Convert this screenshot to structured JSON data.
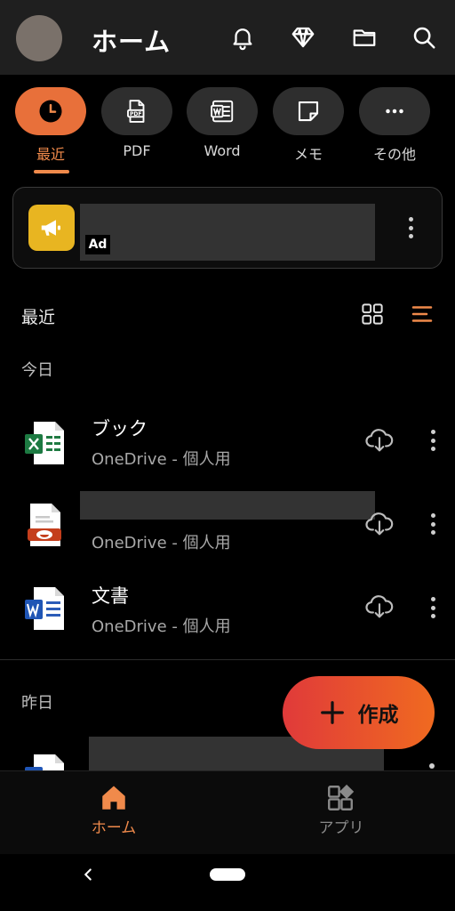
{
  "header": {
    "title": "ホーム",
    "icons": [
      "bell-icon",
      "premium-diamond-icon",
      "folder-icon",
      "search-icon"
    ]
  },
  "categories": [
    {
      "label": "最近",
      "icon": "clock-icon",
      "active": true
    },
    {
      "label": "PDF",
      "icon": "pdf-icon",
      "active": false
    },
    {
      "label": "Word",
      "icon": "word-icon",
      "active": false
    },
    {
      "label": "メモ",
      "icon": "sticky-note-icon",
      "active": false
    },
    {
      "label": "その他",
      "icon": "more-icon",
      "active": false
    }
  ],
  "ad": {
    "badge": "Ad",
    "icon": "megaphone-icon"
  },
  "recent": {
    "title": "最近",
    "view_icons": [
      "grid-view-icon",
      "list-view-icon"
    ]
  },
  "groups": [
    {
      "label": "今日",
      "files": [
        {
          "name": "ブック",
          "location": "OneDrive - 個人用",
          "type": "excel"
        },
        {
          "name": "",
          "location": "OneDrive - 個人用",
          "type": "powerpoint"
        },
        {
          "name": "文書",
          "location": "OneDrive - 個人用",
          "type": "word"
        }
      ]
    },
    {
      "label": "昨日",
      "files": [
        {
          "name": "",
          "location": "",
          "type": "word"
        }
      ]
    }
  ],
  "fab": {
    "label": "作成"
  },
  "bottom_nav": [
    {
      "label": "ホーム",
      "icon": "home-icon",
      "active": true
    },
    {
      "label": "アプリ",
      "icon": "apps-icon",
      "active": false
    }
  ],
  "colors": {
    "accent": "#F08A4B",
    "background": "#000000",
    "header": "#1F1F1F",
    "fab_start": "#E03A3A",
    "fab_end": "#F06A20"
  }
}
